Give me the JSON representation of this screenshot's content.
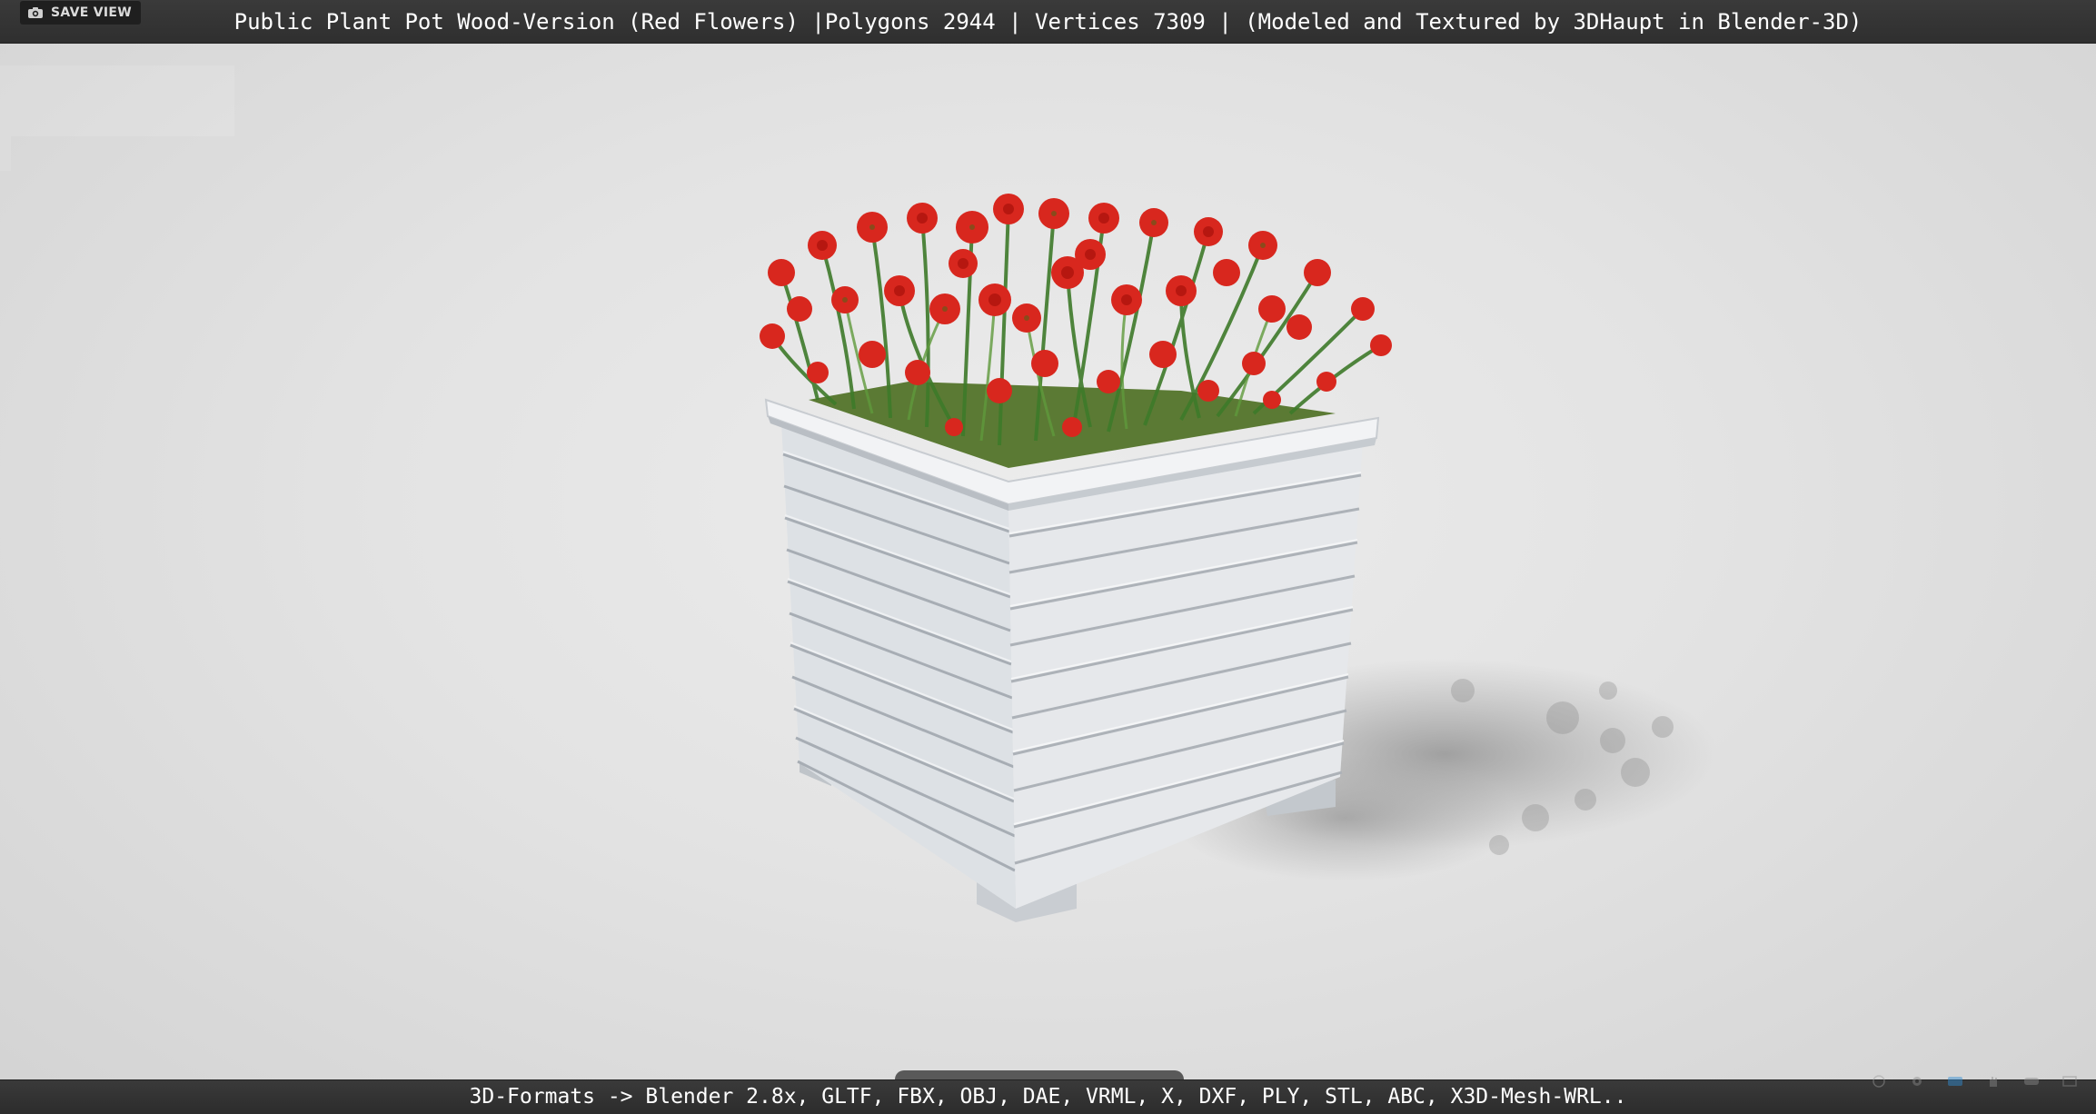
{
  "viewer": {
    "title": "Public Plant Pot Wood-Version (Red Flowers) |Polygons 2944 | Vertices 7309 | (Modeled and Textured by 3DHaupt in Blender-3D)",
    "save_view_label": "SAVE VIEW",
    "formats": "3D-Formats -> Blender 2.8x, GLTF, FBX, OBJ, DAE, VRML, X, DXF, PLY, STL, ABC, X3D-Mesh-WRL.."
  },
  "colors": {
    "bar_background": "#333333",
    "viewport_background": "#e3e3e3",
    "planter": "#dfe2e6",
    "flower": "#d8271e",
    "foliage": "#3e7a2a"
  }
}
